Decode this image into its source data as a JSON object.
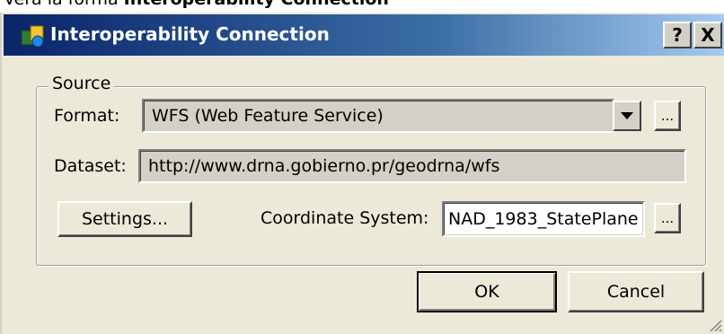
{
  "caption": {
    "prefix": "Verá la forma ",
    "bold": "Interoperability Connection"
  },
  "window": {
    "title": "Interoperability Connection",
    "help_button": "?",
    "close_button": "X"
  },
  "source_group": {
    "legend": "Source",
    "format": {
      "label": "Format:",
      "value": "WFS (Web Feature Service)",
      "browse_label": "..."
    },
    "dataset": {
      "label": "Dataset:",
      "value": "http://www.drna.gobierno.pr/geodrna/wfs"
    },
    "settings_button": "Settings...",
    "coordinate_system": {
      "label": "Coordinate System:",
      "value": "NAD_1983_StatePlane",
      "browse_label": "..."
    }
  },
  "buttons": {
    "ok": "OK",
    "cancel": "Cancel"
  },
  "colors": {
    "titlebar_start": "#0a246a",
    "titlebar_end": "#a6caf0",
    "dialog_bg": "#ece9d8"
  }
}
